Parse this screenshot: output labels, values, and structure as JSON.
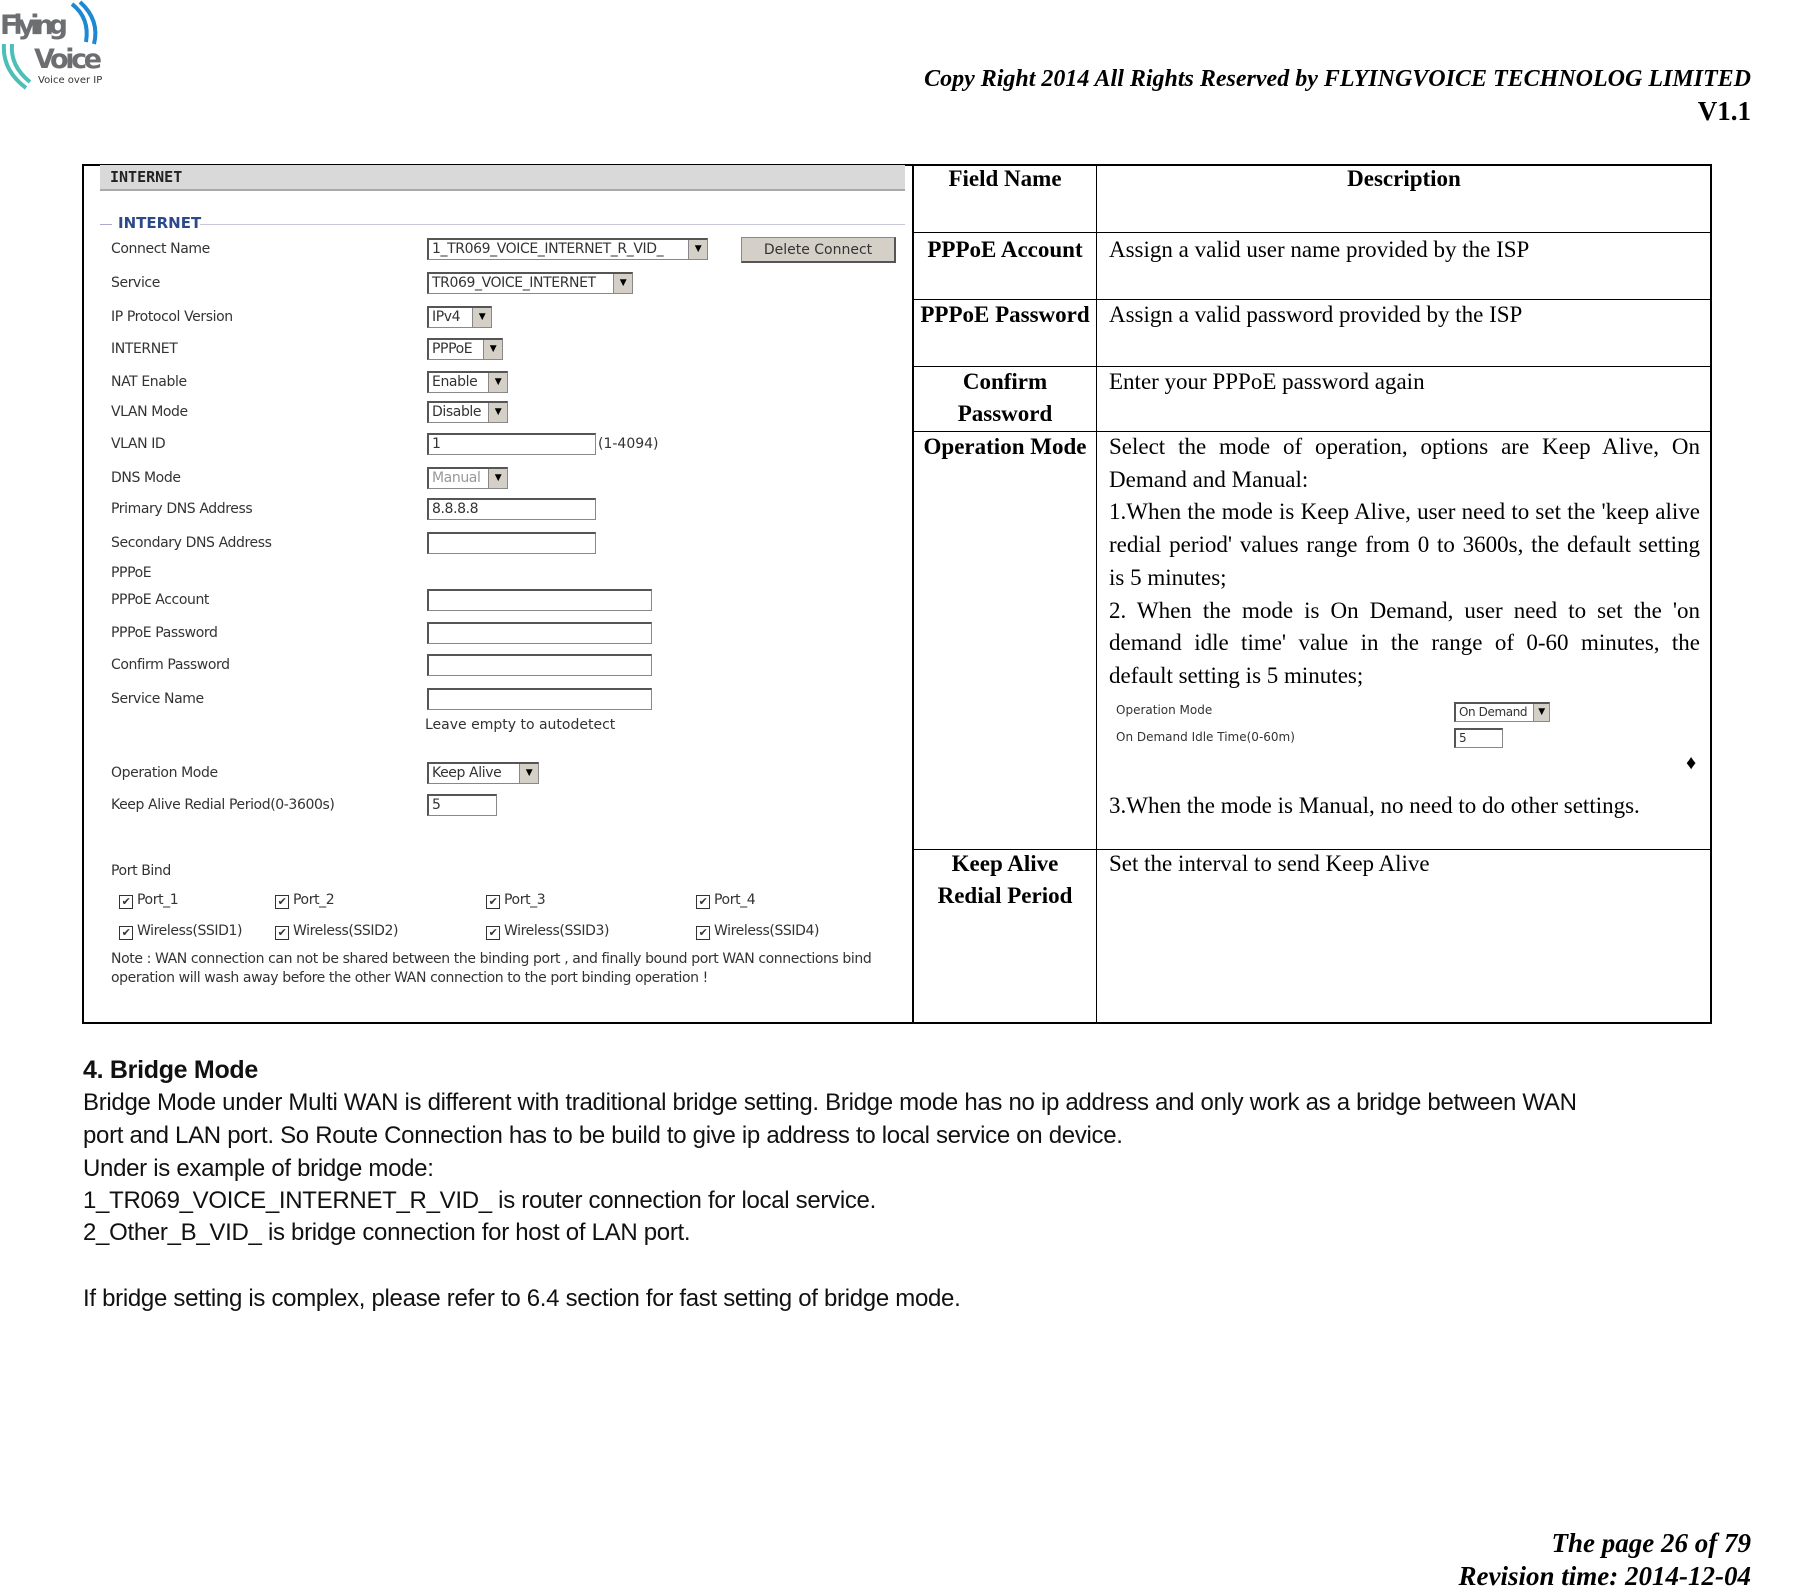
{
  "header": {
    "logo_text": "Flying Voice - Voice over IP",
    "copyright": "Copy Right 2014 All Rights Reserved by FLYINGVOICE TECHNOLOG LIMITED",
    "version": "V1.1"
  },
  "screenshot": {
    "bar_title": "INTERNET",
    "section_title": "INTERNET",
    "delete_button": "Delete Connect",
    "fields": [
      {
        "label": "Connect Name",
        "type": "select",
        "value": "1_TR069_VOICE_INTERNET_R_VID_"
      },
      {
        "label": "Service",
        "type": "select",
        "value": "TR069_VOICE_INTERNET"
      },
      {
        "label": "IP Protocol Version",
        "type": "select",
        "value": "IPv4"
      },
      {
        "label": "INTERNET",
        "type": "select",
        "value": "PPPoE"
      },
      {
        "label": "NAT Enable",
        "type": "select",
        "value": "Enable"
      },
      {
        "label": "VLAN Mode",
        "type": "select",
        "value": "Disable"
      },
      {
        "label": "VLAN ID",
        "type": "input",
        "value": "1",
        "hint": "(1-4094)"
      },
      {
        "label": "DNS Mode",
        "type": "select",
        "value": "Manual",
        "disabled": true
      },
      {
        "label": "Primary DNS Address",
        "type": "input",
        "value": "8.8.8.8"
      },
      {
        "label": "Secondary DNS Address",
        "type": "input",
        "value": ""
      },
      {
        "label": "PPPoE",
        "type": "heading"
      },
      {
        "label": "PPPoE Account",
        "type": "input",
        "value": ""
      },
      {
        "label": "PPPoE Password",
        "type": "input",
        "value": ""
      },
      {
        "label": "Confirm Password",
        "type": "input",
        "value": ""
      },
      {
        "label": "Service Name",
        "type": "input",
        "value": ""
      },
      {
        "label": "",
        "type": "hint",
        "value": "Leave empty to autodetect"
      },
      {
        "label": "Operation Mode",
        "type": "select",
        "value": "Keep Alive"
      },
      {
        "label": "Keep Alive Redial Period(0-3600s)",
        "type": "input",
        "value": "5"
      }
    ],
    "port_bind_label": "Port Bind",
    "ports": [
      {
        "label": "Port_1",
        "checked": true
      },
      {
        "label": "Port_2",
        "checked": true
      },
      {
        "label": "Port_3",
        "checked": true
      },
      {
        "label": "Port_4",
        "checked": true
      },
      {
        "label": "Wireless(SSID1)",
        "checked": true
      },
      {
        "label": "Wireless(SSID2)",
        "checked": true
      },
      {
        "label": "Wireless(SSID3)",
        "checked": true
      },
      {
        "label": "Wireless(SSID4)",
        "checked": true
      }
    ],
    "note_line1": "Note : WAN connection can not be shared between the binding port , and finally bound port WAN connections bind",
    "note_line2": "operation will wash away before the other WAN connection to the port binding operation !"
  },
  "table": {
    "col_field": "Field Name",
    "col_desc": "Description",
    "rows": [
      {
        "field": "PPPoE Account",
        "desc": "Assign a valid user name provided by the ISP"
      },
      {
        "field": "PPPoE Password",
        "desc": "Assign a valid password provided by the ISP"
      },
      {
        "field": "Confirm Password",
        "desc": "Enter your PPPoE password again"
      },
      {
        "field": "Operation Mode",
        "desc1": "Select the mode of operation, options are Keep Alive, On Demand and Manual:",
        "desc2": "1.When the mode is Keep Alive, user need to set the 'keep alive redial period' values range from 0 to 3600s, the default setting is 5 minutes;",
        "desc3": "2. When the mode is On Demand, user need to set the 'on demand idle time' value in the range of 0-60 minutes, the default setting is 5 minutes;",
        "mini_label1": "Operation Mode",
        "mini_value1": "On Demand",
        "mini_label2": "On Demand Idle Time(0-60m)",
        "mini_value2": "5",
        "bullet": "♦",
        "desc4": "3.When the mode is Manual, no need to do other settings."
      },
      {
        "field": "Keep Alive Redial Period",
        "desc": "Set the interval to send Keep Alive"
      }
    ]
  },
  "bridge": {
    "heading": "4.  Bridge Mode",
    "lines": [
      "Bridge Mode under Multi WAN is different with traditional bridge setting. Bridge mode has no ip address and only work as a bridge between WAN",
      "port and LAN port. So Route Connection has to be build to give ip address to local service on device.",
      "Under is example of bridge mode:",
      "1_TR069_VOICE_INTERNET_R_VID_ is router connection for local service.",
      "2_Other_B_VID_ is bridge connection for host of LAN port.",
      "If bridge setting is complex, please refer to 6.4 section for fast setting of bridge mode."
    ]
  },
  "footer": {
    "page": "The page 26 of 79",
    "revision": "Revision time: 2014-12-04"
  }
}
